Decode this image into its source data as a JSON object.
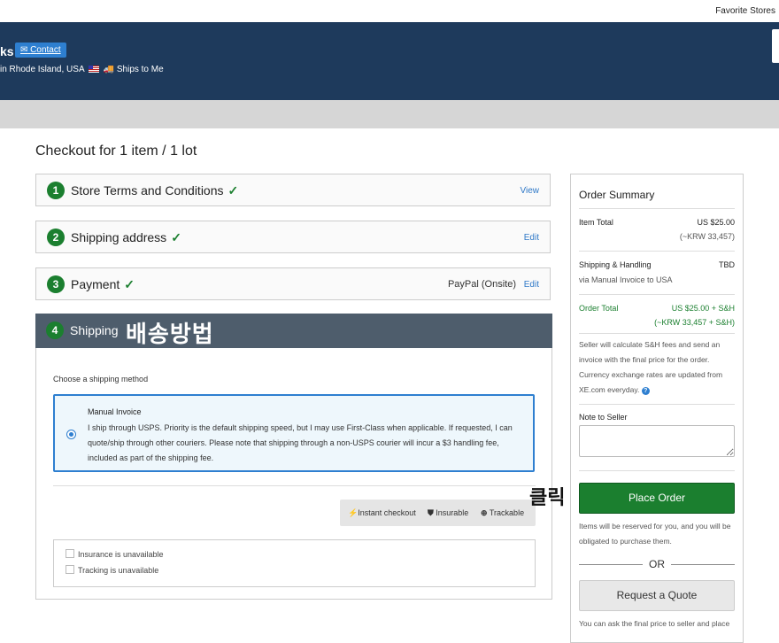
{
  "topbar": {
    "favorite_stores": "Favorite Stores"
  },
  "header": {
    "store_suffix": "ks",
    "contact_label": "Contact",
    "location": "in Rhode Island, USA",
    "ships_to": "Ships to Me"
  },
  "checkout": {
    "title": "Checkout for 1 item / 1 lot",
    "steps": [
      {
        "num": "1",
        "label": "Store Terms and Conditions",
        "check": "✓",
        "action": "View"
      },
      {
        "num": "2",
        "label": "Shipping address",
        "check": "✓",
        "action": "Edit"
      },
      {
        "num": "3",
        "label": "Payment",
        "check": "✓",
        "payment_method": "PayPal (Onsite)",
        "action": "Edit"
      }
    ],
    "shipping": {
      "num": "4",
      "label": "Shipping",
      "annotation": "배송방법",
      "choose_label": "Choose a shipping method",
      "method_name": "Manual Invoice",
      "method_desc": "I ship through USPS. Priority is the default shipping speed, but I may use First-Class when applicable. If requested, I can quote/ship through other couriers. Please note that shipping through a non-USPS courier will incur a $3 handling fee, included as part of the shipping fee.",
      "features": [
        "Instant checkout",
        "Insurable",
        "Trackable"
      ],
      "options": [
        "Insurance is unavailable",
        "Tracking is unavailable"
      ]
    }
  },
  "annotation_click": "클릭",
  "summary": {
    "title": "Order Summary",
    "item_total_label": "Item Total",
    "item_total_value": "US $25.00",
    "item_total_krw": "(~KRW 33,457)",
    "sh_label": "Shipping & Handling",
    "sh_value": "TBD",
    "sh_via": "via Manual Invoice to USA",
    "order_total_label": "Order Total",
    "order_total_value": "US $25.00 + S&H",
    "order_total_krw": "(~KRW 33,457 + S&H)",
    "seller_note_1": "Seller will calculate S&H fees and send an invoice with the final price for the order.",
    "seller_note_2": "Currency exchange rates are updated from XE.com everyday.",
    "note_to_seller_label": "Note to Seller",
    "place_order": "Place Order",
    "reserved_note": "Items will be reserved for you, and you will be obligated to purchase them.",
    "or": "OR",
    "request_quote": "Request a Quote",
    "quote_note": "You can ask the final price to seller and place"
  },
  "colors": {
    "header_bg": "#1e3a5c",
    "green": "#1b7f2f",
    "link": "#2e78c7"
  }
}
